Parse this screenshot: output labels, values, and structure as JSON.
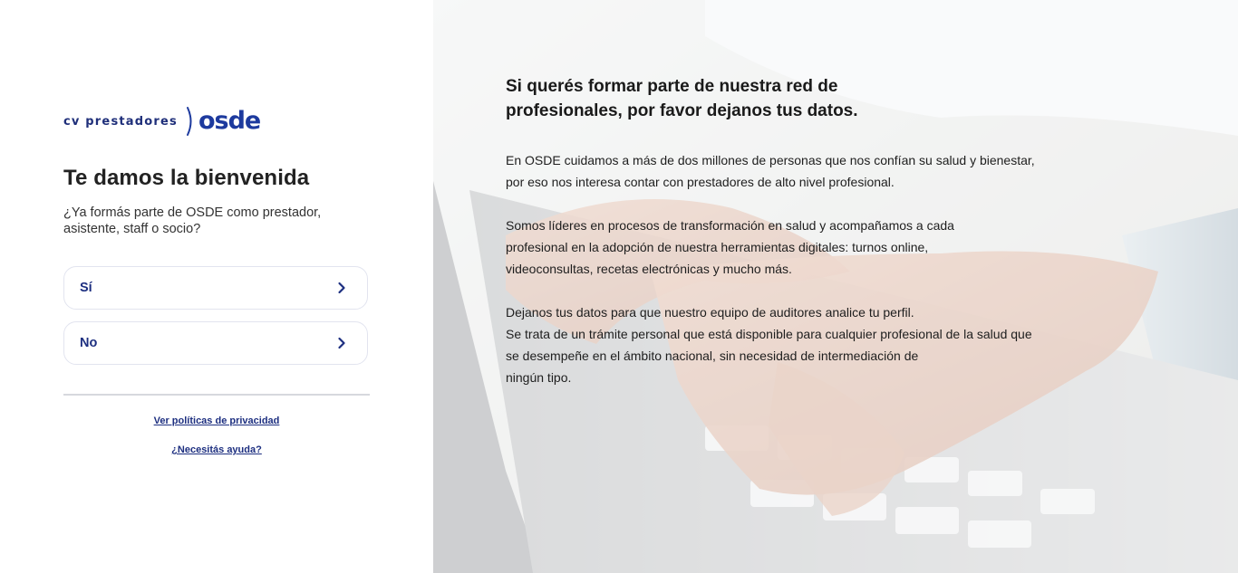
{
  "brand": {
    "prefix": "cv prestadores",
    "name": "osde"
  },
  "welcome": {
    "title": "Te damos la bienvenida",
    "question_line1": "¿Ya formás parte de OSDE como prestador,",
    "question_line2": "asistente, staff o socio?"
  },
  "options": [
    {
      "label": "Sí",
      "icon": "chevron-right-icon"
    },
    {
      "label": "No",
      "icon": "chevron-right-icon"
    }
  ],
  "links": {
    "privacy": "Ver políticas de privacidad",
    "help": "¿Necesitás ayuda?"
  },
  "info": {
    "title_line1": "Si querés formar parte de nuestra red de",
    "title_line2": "profesionales, por favor dejanos tus datos.",
    "p1_line1": "En OSDE cuidamos a más de dos millones de personas que nos confían su salud y bienestar,",
    "p1_line2": "por eso nos interesa contar con prestadores de alto nivel profesional.",
    "p2_line1": "Somos líderes en procesos de transformación en salud y acompañamos a cada",
    "p2_line2": "profesional en la adopción de nuestra herramientas digitales: turnos online,",
    "p2_line3": "videoconsultas, recetas electrónicas y mucho más.",
    "p3_line1": "Dejanos tus datos para que nuestro equipo de auditores analice tu perfil.",
    "p3_line2": "Se trata de un trámite personal que está disponible para cualquier profesional de la salud que",
    "p3_line3": "se desempeñe en el ámbito nacional, sin necesidad de intermediación de",
    "p3_line4": "ningún tipo."
  },
  "colors": {
    "brand_blue": "#1d3a9e",
    "text_navy": "#1d2f80",
    "title_dark": "#222222"
  }
}
